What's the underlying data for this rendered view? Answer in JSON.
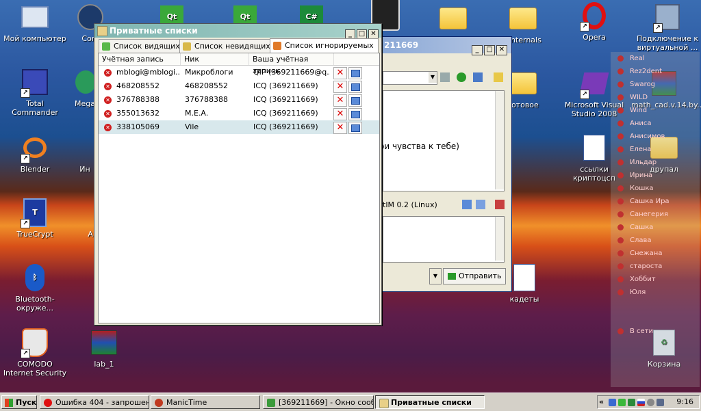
{
  "desktop": {
    "icons": [
      {
        "label": "Мой компьютер",
        "icon": "my-computer-icon"
      },
      {
        "label": "Com",
        "icon": "commander-icon"
      },
      {
        "label": "Qt",
        "icon": "qt-icon"
      },
      {
        "label": "Qt",
        "icon": "qt-icon"
      },
      {
        "label": "C#",
        "icon": "csharp-icon"
      },
      {
        "label": "sinternals",
        "icon": "folder-icon"
      },
      {
        "label": "Opera",
        "icon": "opera-icon"
      },
      {
        "label": "Подключение к виртуальной ...",
        "icon": "network-icon"
      },
      {
        "label": "Total Commander",
        "icon": "floppy-icon"
      },
      {
        "label": "Mega",
        "icon": "mega-icon"
      },
      {
        "label": "готовое",
        "icon": "folder-icon"
      },
      {
        "label": "Microsoft Visual Studio 2008",
        "icon": "visual-studio-icon"
      },
      {
        "label": "math_cad.v.14.by....",
        "icon": "rar-archive-icon"
      },
      {
        "label": "Blender",
        "icon": "blender-icon"
      },
      {
        "label": "Ин",
        "icon": "app-icon"
      },
      {
        "label": "ссылки криптоцсп",
        "icon": "word-document-icon"
      },
      {
        "label": "друпал",
        "icon": "folder-icon"
      },
      {
        "label": "TrueCrypt",
        "icon": "truecrypt-icon"
      },
      {
        "label": "A",
        "icon": "app-icon"
      },
      {
        "label": "Bluetooth-окруже...",
        "icon": "bluetooth-icon"
      },
      {
        "label": "кадеты",
        "icon": "word-document-icon"
      },
      {
        "label": "COMODO Internet Security",
        "icon": "comodo-icon"
      },
      {
        "label": "lab_1",
        "icon": "rar-archive-icon"
      },
      {
        "label": "Корзина",
        "icon": "recycle-bin-icon"
      }
    ]
  },
  "background_window": {
    "title_suffix": "211669",
    "message_fragment": "ои чувства  к тебе)",
    "client_label": "tIM 0.2 (Linux)",
    "send_label": "Отправить"
  },
  "contacts": [
    "Real",
    "Rez2dent",
    "Swarog",
    "WILD",
    "Wind",
    "Аниса",
    "Анисимов",
    "Елена",
    "Ильдар",
    "Ирина",
    "Кошка",
    "Сашка Ира",
    "Санегерия",
    "Сашка",
    "Слава",
    "Снежана",
    "староста",
    "Хоббит",
    "Юля",
    "В сети"
  ],
  "private_lists": {
    "title": "Приватные списки",
    "tabs": [
      {
        "label": "Список видящих"
      },
      {
        "label": "Список невидящих"
      },
      {
        "label": "Список игнорируемых"
      }
    ],
    "active_tab": 2,
    "columns": [
      "Учётная запись",
      "Ник",
      "Ваша учётная запись"
    ],
    "rows": [
      {
        "account": "mblogi@mblogi....",
        "nick": "Микроблоги",
        "your_account": "QIP (369211669@q..."
      },
      {
        "account": "468208552",
        "nick": "468208552",
        "your_account": "ICQ (369211669)"
      },
      {
        "account": "376788388",
        "nick": "376788388",
        "your_account": "ICQ (369211669)"
      },
      {
        "account": "355013632",
        "nick": "M.E.A.",
        "your_account": "ICQ (369211669)"
      },
      {
        "account": "338105069",
        "nick": "Vile",
        "your_account": "ICQ (369211669)"
      }
    ],
    "selected_row": 4
  },
  "taskbar": {
    "start_label": "Пуск",
    "tasks": [
      {
        "label": "Ошибка 404 - запрошен...",
        "icon": "opera-icon"
      },
      {
        "label": "ManicTime",
        "icon": "manictime-icon"
      },
      {
        "label": "[369211669] - Окно сооб...",
        "icon": "qip-message-icon"
      },
      {
        "label": "Приватные списки",
        "icon": "private-list-icon"
      }
    ],
    "clock": "9:16"
  },
  "colors": {
    "title_active": "#7fb5b0",
    "selected_row": "#d8e8ec",
    "delete_red": "#d00000"
  }
}
